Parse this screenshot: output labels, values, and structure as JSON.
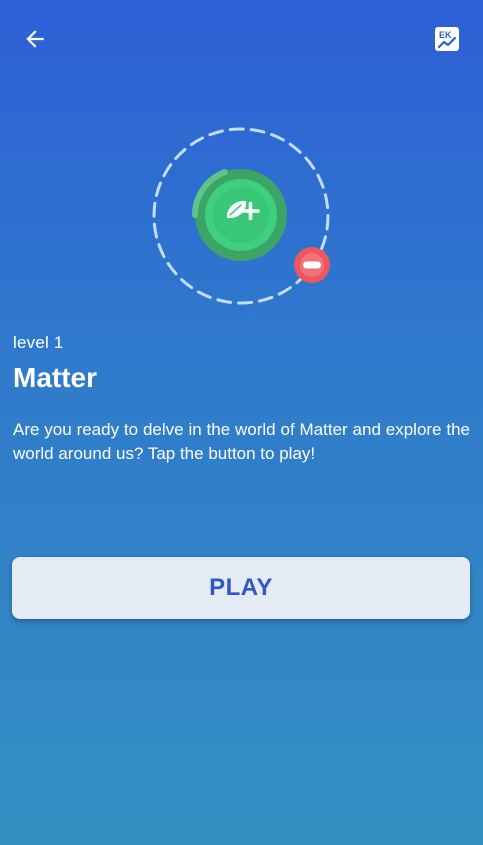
{
  "header": {
    "back_icon": "arrow-left-icon",
    "stats_icon": "stats-chart-icon",
    "stats_icon_text": "EK"
  },
  "hero": {
    "illustration": "matter-atom-illustration",
    "plus_color": "#3fcf7f",
    "minus_color": "#ef5561"
  },
  "level": {
    "label": "level 1",
    "title": "Matter",
    "description": "Are you ready to delve in the world of Matter and explore the world around us? Tap the button to play!"
  },
  "actions": {
    "play_label": "PLAY"
  },
  "colors": {
    "background_top": "#2d5fd6",
    "background_bottom": "#3490c2",
    "button_bg": "#e4ebf4",
    "button_text": "#2f58c5"
  }
}
